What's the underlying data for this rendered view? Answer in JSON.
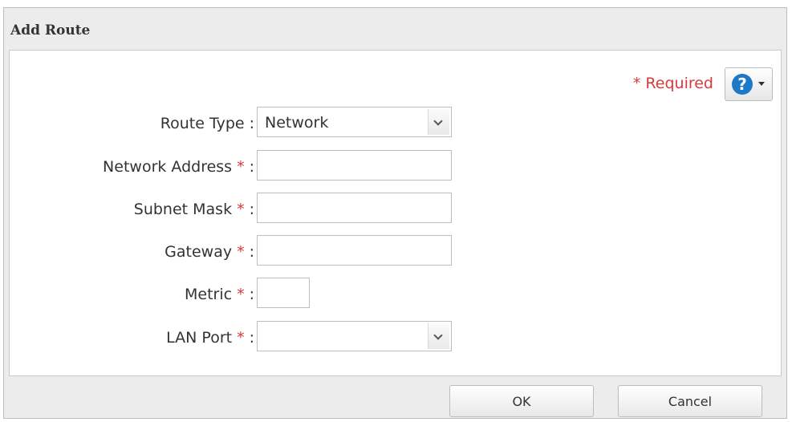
{
  "dialog": {
    "title": "Add Route",
    "required_text": "* Required",
    "help_icon_glyph": "?"
  },
  "form": {
    "route_type": {
      "label": "Route Type",
      "value": "Network"
    },
    "network_address": {
      "label": "Network Address",
      "star": "*",
      "value": ""
    },
    "subnet_mask": {
      "label": "Subnet Mask",
      "star": "*",
      "value": ""
    },
    "gateway": {
      "label": "Gateway",
      "star": "*",
      "value": ""
    },
    "metric": {
      "label": "Metric",
      "star": "*",
      "value": ""
    },
    "lan_port": {
      "label": "LAN Port",
      "star": "*",
      "value": ""
    }
  },
  "buttons": {
    "ok_label": "OK",
    "cancel_label": "Cancel"
  },
  "colors": {
    "required_red": "#d83a3a",
    "help_blue": "#1d78c8"
  },
  "icons": {
    "help": "help-icon",
    "dropdown": "chevron-down-icon"
  }
}
